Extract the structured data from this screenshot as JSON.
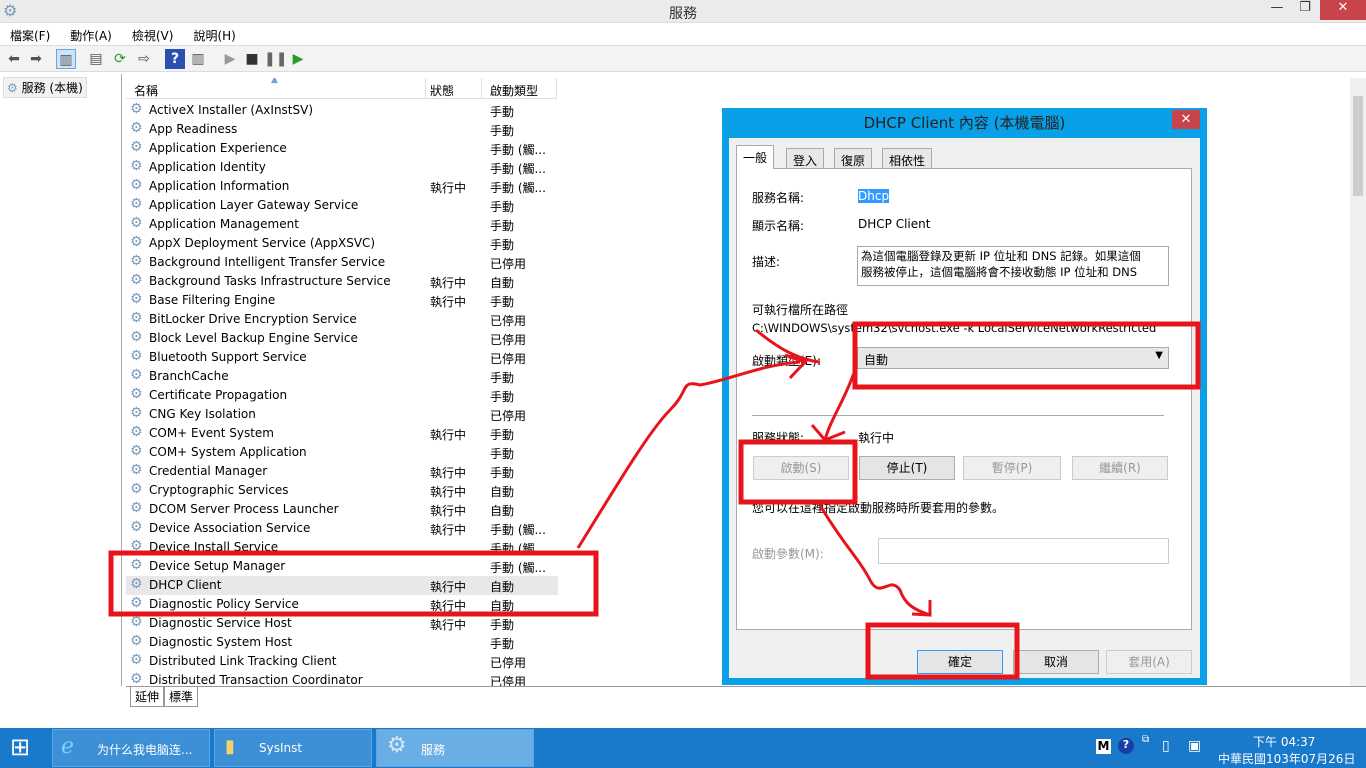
{
  "window": {
    "title": "服務",
    "minimize": "—",
    "restore": "❐",
    "close": "✕"
  },
  "menu": [
    "檔案(F)",
    "動作(A)",
    "檢視(V)",
    "說明(H)"
  ],
  "tree": {
    "root": "服務 (本機)"
  },
  "columns": {
    "name": "名稱",
    "status": "狀態",
    "startup": "啟動類型"
  },
  "services": [
    {
      "name": "ActiveX Installer (AxInstSV)",
      "status": "",
      "startup": "手動"
    },
    {
      "name": "App Readiness",
      "status": "",
      "startup": "手動"
    },
    {
      "name": "Application Experience",
      "status": "",
      "startup": "手動 (觸..."
    },
    {
      "name": "Application Identity",
      "status": "",
      "startup": "手動 (觸..."
    },
    {
      "name": "Application Information",
      "status": "執行中",
      "startup": "手動 (觸..."
    },
    {
      "name": "Application Layer Gateway Service",
      "status": "",
      "startup": "手動"
    },
    {
      "name": "Application Management",
      "status": "",
      "startup": "手動"
    },
    {
      "name": "AppX Deployment Service (AppXSVC)",
      "status": "",
      "startup": "手動"
    },
    {
      "name": "Background Intelligent Transfer Service",
      "status": "",
      "startup": "已停用"
    },
    {
      "name": "Background Tasks Infrastructure Service",
      "status": "執行中",
      "startup": "自動"
    },
    {
      "name": "Base Filtering Engine",
      "status": "執行中",
      "startup": "手動"
    },
    {
      "name": "BitLocker Drive Encryption Service",
      "status": "",
      "startup": "已停用"
    },
    {
      "name": "Block Level Backup Engine Service",
      "status": "",
      "startup": "已停用"
    },
    {
      "name": "Bluetooth Support Service",
      "status": "",
      "startup": "已停用"
    },
    {
      "name": "BranchCache",
      "status": "",
      "startup": "手動"
    },
    {
      "name": "Certificate Propagation",
      "status": "",
      "startup": "手動"
    },
    {
      "name": "CNG Key Isolation",
      "status": "",
      "startup": "已停用"
    },
    {
      "name": "COM+ Event System",
      "status": "執行中",
      "startup": "手動"
    },
    {
      "name": "COM+ System Application",
      "status": "",
      "startup": "手動"
    },
    {
      "name": "Credential Manager",
      "status": "執行中",
      "startup": "手動"
    },
    {
      "name": "Cryptographic Services",
      "status": "執行中",
      "startup": "自動"
    },
    {
      "name": "DCOM Server Process Launcher",
      "status": "執行中",
      "startup": "自動"
    },
    {
      "name": "Device Association Service",
      "status": "執行中",
      "startup": "手動 (觸..."
    },
    {
      "name": "Device Install Service",
      "status": "",
      "startup": "手動 (觸..."
    },
    {
      "name": "Device Setup Manager",
      "status": "",
      "startup": "手動 (觸..."
    },
    {
      "name": "DHCP Client",
      "status": "執行中",
      "startup": "自動"
    },
    {
      "name": "Diagnostic Policy Service",
      "status": "執行中",
      "startup": "自動"
    },
    {
      "name": "Diagnostic Service Host",
      "status": "執行中",
      "startup": "手動"
    },
    {
      "name": "Diagnostic System Host",
      "status": "",
      "startup": "手動"
    },
    {
      "name": "Distributed Link Tracking Client",
      "status": "",
      "startup": "已停用"
    },
    {
      "name": "Distributed Transaction Coordinator",
      "status": "",
      "startup": "已停用"
    }
  ],
  "bottom_tabs": [
    "延伸",
    "標準"
  ],
  "dialog": {
    "title": "DHCP Client 內容 (本機電腦)",
    "close": "✕",
    "tabs": [
      "一般",
      "登入",
      "復原",
      "相依性"
    ],
    "service_name_label": "服務名稱:",
    "service_name": "Dhcp",
    "display_name_label": "顯示名稱:",
    "display_name": "DHCP Client",
    "description_label": "描述:",
    "description": "為這個電腦登錄及更新 IP 位址和 DNS 記錄。如果這個服務被停止，這個電腦將會不接收動態 IP 位址和 DNS",
    "path_label": "可執行檔所在路徑",
    "path": "C:\\WINDOWS\\system32\\svchost.exe -k LocalServiceNetworkRestricted",
    "startup_label": "啟動類型(E):",
    "startup_value": "自動",
    "status_label": "服務狀態:",
    "status_value": "執行中",
    "btn_start": "啟動(S)",
    "btn_stop": "停止(T)",
    "btn_pause": "暫停(P)",
    "btn_resume": "繼續(R)",
    "param_hint": "您可以在這裡指定啟動服務時所要套用的參數。",
    "param_label": "啟動參數(M):",
    "ok": "確定",
    "cancel": "取消",
    "apply": "套用(A)"
  },
  "taskbar": {
    "items": [
      "为什么我电脑连...",
      "SysInst",
      "服務"
    ],
    "time": "下午 04:37",
    "date": "中華民國103年07月26日"
  },
  "annotation_color": "#e8141c"
}
